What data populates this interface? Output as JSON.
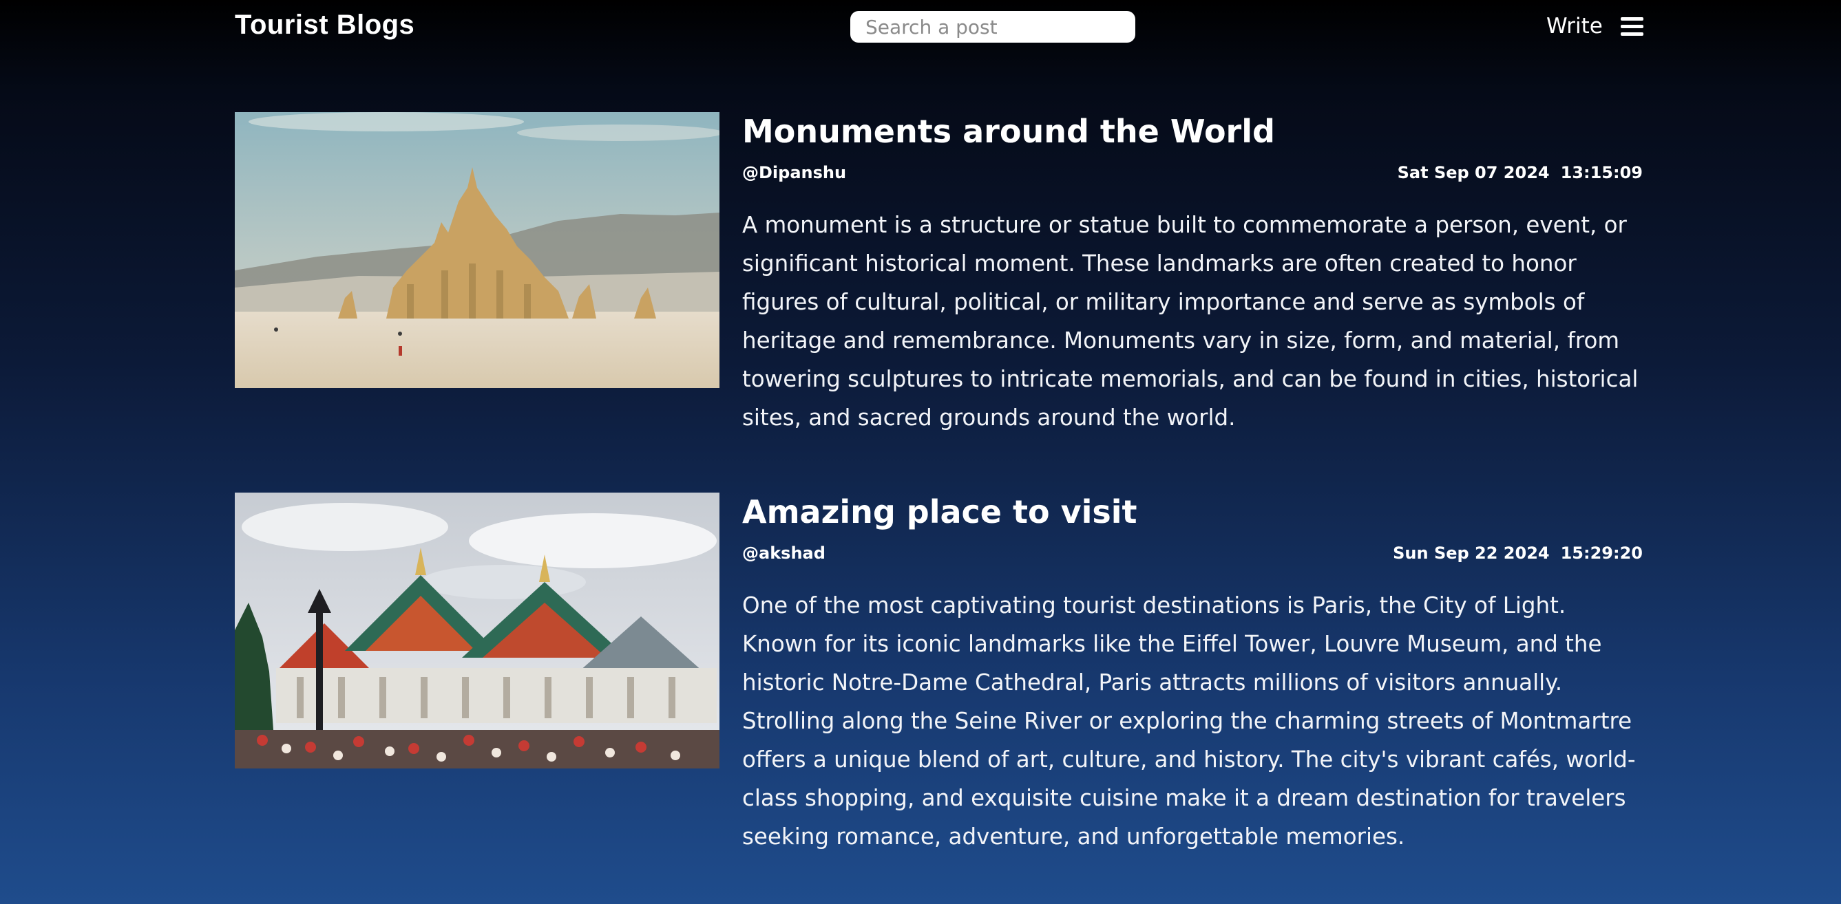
{
  "header": {
    "brand": "Tourist Blogs",
    "search_placeholder": "Search a post",
    "write_label": "Write"
  },
  "posts": [
    {
      "title": "Monuments around the World",
      "author": "@Dipanshu",
      "date": "Sat Sep 07 2024",
      "time": "13:15:09",
      "body": "A monument is a structure or statue built to commemorate a person, event, or significant historical moment. These landmarks are often created to honor figures of cultural, political, or military importance and serve as symbols of heritage and remembrance. Monuments vary in size, form, and material, from towering sculptures to intricate memorials, and can be found in cities, historical sites, and sacred grounds around the world."
    },
    {
      "title": "Amazing place to visit",
      "author": "@akshad",
      "date": "Sun Sep 22 2024",
      "time": "15:29:20",
      "body": "One of the most captivating tourist destinations is Paris, the City of Light. Known for its iconic landmarks like the Eiffel Tower, Louvre Museum, and the historic Notre-Dame Cathedral, Paris attracts millions of visitors annually. Strolling along the Seine River or exploring the charming streets of Montmartre offers a unique blend of art, culture, and history. The city's vibrant cafés, world-class shopping, and exquisite cuisine make it a dream destination for travelers seeking romance, adventure, and unforgettable memories."
    }
  ]
}
